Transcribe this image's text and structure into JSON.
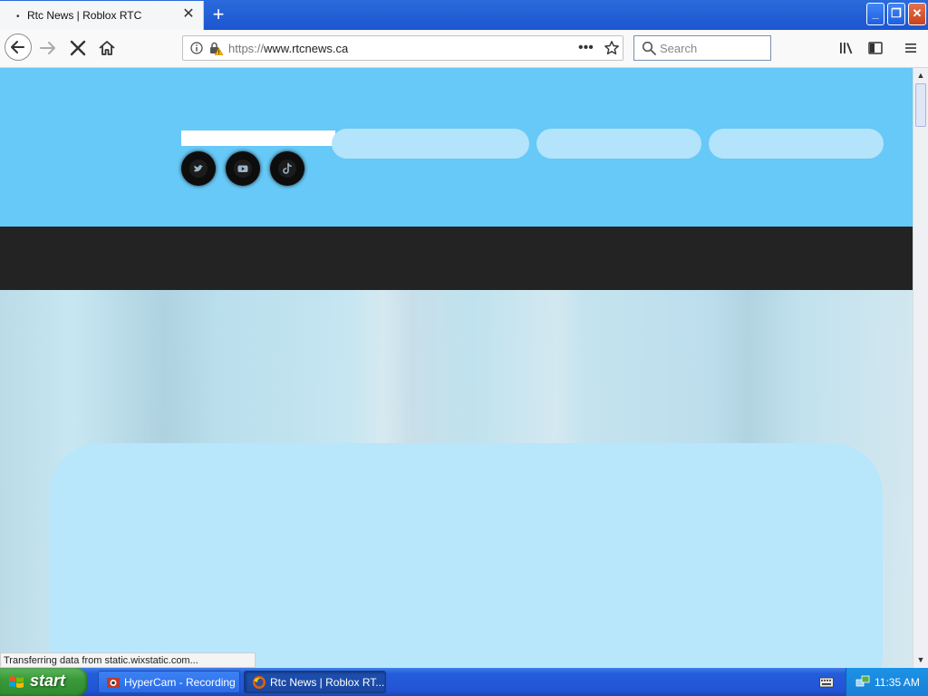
{
  "browser": {
    "tab": {
      "title": "Rtc News | Roblox RTC",
      "loading_indicator": "•",
      "close": "✕"
    },
    "new_tab": "+",
    "window_controls": {
      "minimize": "_",
      "maximize": "❐",
      "close": "✕"
    },
    "url": {
      "protocol": "https://",
      "host": "www.rtcnews.ca"
    },
    "page_actions": "•••",
    "search": {
      "placeholder": "Search",
      "value": ""
    },
    "status_text": "Transferring data from static.wixstatic.com..."
  },
  "page": {
    "colors": {
      "header": "#66c9f7",
      "dark_band": "#232323",
      "nav_pill": "#b3e4fb",
      "panel": "#b8e6fb"
    },
    "social_icons": [
      "twitter-icon",
      "youtube-icon",
      "tiktok-icon"
    ]
  },
  "scrollbar": {
    "up": "▲",
    "down": "▼"
  },
  "taskbar": {
    "start_label": "start",
    "tasks": [
      {
        "label": "HyperCam - Recording"
      },
      {
        "label": "Rtc News | Roblox RT..."
      }
    ],
    "clock": "11:35 AM"
  }
}
